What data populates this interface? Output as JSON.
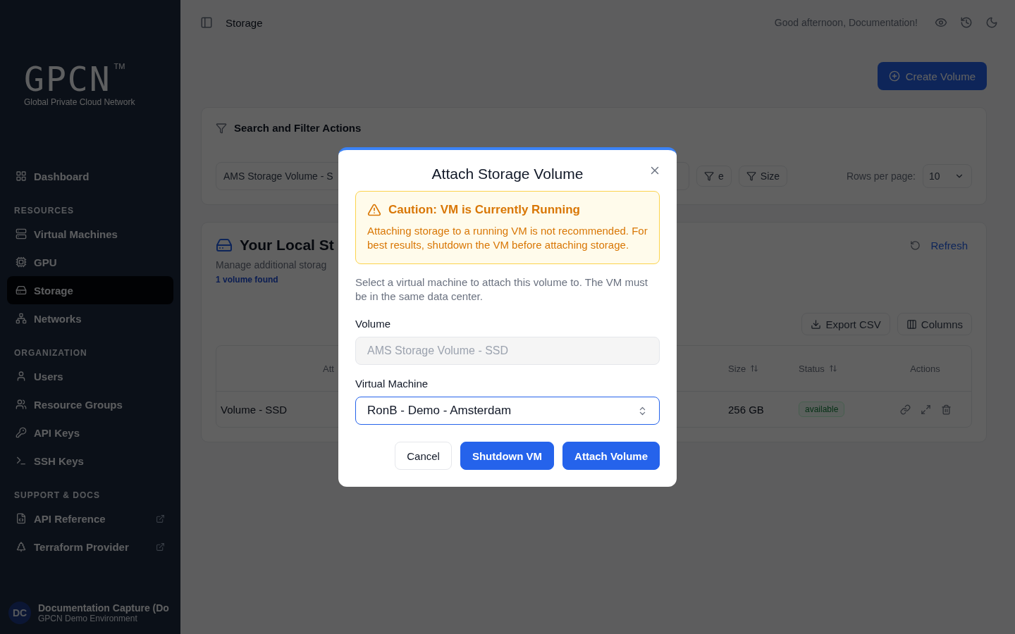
{
  "sidebar": {
    "logo": {
      "wordmark": "GPCN",
      "trademark": "TM",
      "tagline": "Global Private Cloud Network"
    },
    "sections": [
      {
        "items": [
          {
            "label": "Dashboard",
            "selected": false,
            "external": false
          }
        ]
      },
      {
        "heading": "RESOURCES",
        "items": [
          {
            "label": "Virtual Machines",
            "selected": false,
            "external": false
          },
          {
            "label": "GPU",
            "selected": false,
            "external": false
          },
          {
            "label": "Storage",
            "selected": true,
            "external": false
          },
          {
            "label": "Networks",
            "selected": false,
            "external": false
          }
        ]
      },
      {
        "heading": "ORGANIZATION",
        "items": [
          {
            "label": "Users",
            "selected": false,
            "external": false
          },
          {
            "label": "Resource Groups",
            "selected": false,
            "external": false
          },
          {
            "label": "API Keys",
            "selected": false,
            "external": false
          },
          {
            "label": "SSH Keys",
            "selected": false,
            "external": false
          }
        ]
      },
      {
        "heading": "SUPPORT & DOCS",
        "items": [
          {
            "label": "API Reference",
            "selected": false,
            "external": true
          },
          {
            "label": "Terraform Provider",
            "selected": false,
            "external": true
          }
        ]
      }
    ],
    "user": {
      "initials": "DC",
      "name": "Documentation Capture (Do",
      "subtitle": "GPCN Demo Environment"
    }
  },
  "header": {
    "title": "Storage",
    "greeting": "Good afternoon, Documentation!"
  },
  "create_button": "Create Volume",
  "filters": {
    "title": "Search and Filter Actions",
    "search_value": "AMS Storage Volume - S",
    "chips": [
      "e",
      "Size"
    ],
    "rows_label": "Rows per page:",
    "rows_value": "10"
  },
  "volumes": {
    "title": "Your Local St",
    "subtitle": "Manage additional storag",
    "count": "1 volume found",
    "refresh": "Refresh",
    "tools": [
      "Export CSV",
      "Columns"
    ],
    "columns": [
      {},
      {
        "label": "Att"
      },
      {
        "label": "Size",
        "sortable": true
      },
      {
        "label": "Status",
        "sortable": true
      },
      {
        "label": "Actions",
        "sortable": false
      }
    ],
    "rows": [
      {
        "name": "Volume - SSD",
        "size": "256 GB",
        "status": "available"
      }
    ]
  },
  "modal": {
    "title": "Attach Storage Volume",
    "alert": {
      "title": "Caution: VM is Currently Running",
      "text": "Attaching storage to a running VM is not recommended. For best results, shutdown the VM before attaching storage."
    },
    "description": "Select a virtual machine to attach this volume to. The VM must be in the same data center.",
    "fields": [
      {
        "kind": "readonly",
        "label": "Volume",
        "value": "AMS Storage Volume - SSD"
      },
      {
        "kind": "select",
        "label": "Virtual Machine",
        "value": "RonB - Demo - Amsterdam"
      }
    ],
    "buttons": [
      {
        "kind": "secondary",
        "label": "Cancel"
      },
      {
        "kind": "primary",
        "label": "Shutdown VM"
      },
      {
        "kind": "primary",
        "label": "Attach Volume"
      }
    ]
  }
}
